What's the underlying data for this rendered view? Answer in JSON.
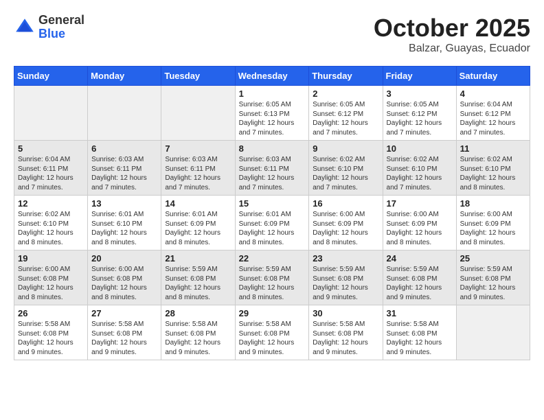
{
  "header": {
    "logo_general": "General",
    "logo_blue": "Blue",
    "month_title": "October 2025",
    "location": "Balzar, Guayas, Ecuador"
  },
  "days_of_week": [
    "Sunday",
    "Monday",
    "Tuesday",
    "Wednesday",
    "Thursday",
    "Friday",
    "Saturday"
  ],
  "weeks": [
    {
      "shaded": false,
      "days": [
        {
          "num": "",
          "info": ""
        },
        {
          "num": "",
          "info": ""
        },
        {
          "num": "",
          "info": ""
        },
        {
          "num": "1",
          "info": "Sunrise: 6:05 AM\nSunset: 6:13 PM\nDaylight: 12 hours\nand 7 minutes."
        },
        {
          "num": "2",
          "info": "Sunrise: 6:05 AM\nSunset: 6:12 PM\nDaylight: 12 hours\nand 7 minutes."
        },
        {
          "num": "3",
          "info": "Sunrise: 6:05 AM\nSunset: 6:12 PM\nDaylight: 12 hours\nand 7 minutes."
        },
        {
          "num": "4",
          "info": "Sunrise: 6:04 AM\nSunset: 6:12 PM\nDaylight: 12 hours\nand 7 minutes."
        }
      ]
    },
    {
      "shaded": true,
      "days": [
        {
          "num": "5",
          "info": "Sunrise: 6:04 AM\nSunset: 6:11 PM\nDaylight: 12 hours\nand 7 minutes."
        },
        {
          "num": "6",
          "info": "Sunrise: 6:03 AM\nSunset: 6:11 PM\nDaylight: 12 hours\nand 7 minutes."
        },
        {
          "num": "7",
          "info": "Sunrise: 6:03 AM\nSunset: 6:11 PM\nDaylight: 12 hours\nand 7 minutes."
        },
        {
          "num": "8",
          "info": "Sunrise: 6:03 AM\nSunset: 6:11 PM\nDaylight: 12 hours\nand 7 minutes."
        },
        {
          "num": "9",
          "info": "Sunrise: 6:02 AM\nSunset: 6:10 PM\nDaylight: 12 hours\nand 7 minutes."
        },
        {
          "num": "10",
          "info": "Sunrise: 6:02 AM\nSunset: 6:10 PM\nDaylight: 12 hours\nand 7 minutes."
        },
        {
          "num": "11",
          "info": "Sunrise: 6:02 AM\nSunset: 6:10 PM\nDaylight: 12 hours\nand 8 minutes."
        }
      ]
    },
    {
      "shaded": false,
      "days": [
        {
          "num": "12",
          "info": "Sunrise: 6:02 AM\nSunset: 6:10 PM\nDaylight: 12 hours\nand 8 minutes."
        },
        {
          "num": "13",
          "info": "Sunrise: 6:01 AM\nSunset: 6:10 PM\nDaylight: 12 hours\nand 8 minutes."
        },
        {
          "num": "14",
          "info": "Sunrise: 6:01 AM\nSunset: 6:09 PM\nDaylight: 12 hours\nand 8 minutes."
        },
        {
          "num": "15",
          "info": "Sunrise: 6:01 AM\nSunset: 6:09 PM\nDaylight: 12 hours\nand 8 minutes."
        },
        {
          "num": "16",
          "info": "Sunrise: 6:00 AM\nSunset: 6:09 PM\nDaylight: 12 hours\nand 8 minutes."
        },
        {
          "num": "17",
          "info": "Sunrise: 6:00 AM\nSunset: 6:09 PM\nDaylight: 12 hours\nand 8 minutes."
        },
        {
          "num": "18",
          "info": "Sunrise: 6:00 AM\nSunset: 6:09 PM\nDaylight: 12 hours\nand 8 minutes."
        }
      ]
    },
    {
      "shaded": true,
      "days": [
        {
          "num": "19",
          "info": "Sunrise: 6:00 AM\nSunset: 6:08 PM\nDaylight: 12 hours\nand 8 minutes."
        },
        {
          "num": "20",
          "info": "Sunrise: 6:00 AM\nSunset: 6:08 PM\nDaylight: 12 hours\nand 8 minutes."
        },
        {
          "num": "21",
          "info": "Sunrise: 5:59 AM\nSunset: 6:08 PM\nDaylight: 12 hours\nand 8 minutes."
        },
        {
          "num": "22",
          "info": "Sunrise: 5:59 AM\nSunset: 6:08 PM\nDaylight: 12 hours\nand 8 minutes."
        },
        {
          "num": "23",
          "info": "Sunrise: 5:59 AM\nSunset: 6:08 PM\nDaylight: 12 hours\nand 9 minutes."
        },
        {
          "num": "24",
          "info": "Sunrise: 5:59 AM\nSunset: 6:08 PM\nDaylight: 12 hours\nand 9 minutes."
        },
        {
          "num": "25",
          "info": "Sunrise: 5:59 AM\nSunset: 6:08 PM\nDaylight: 12 hours\nand 9 minutes."
        }
      ]
    },
    {
      "shaded": false,
      "days": [
        {
          "num": "26",
          "info": "Sunrise: 5:58 AM\nSunset: 6:08 PM\nDaylight: 12 hours\nand 9 minutes."
        },
        {
          "num": "27",
          "info": "Sunrise: 5:58 AM\nSunset: 6:08 PM\nDaylight: 12 hours\nand 9 minutes."
        },
        {
          "num": "28",
          "info": "Sunrise: 5:58 AM\nSunset: 6:08 PM\nDaylight: 12 hours\nand 9 minutes."
        },
        {
          "num": "29",
          "info": "Sunrise: 5:58 AM\nSunset: 6:08 PM\nDaylight: 12 hours\nand 9 minutes."
        },
        {
          "num": "30",
          "info": "Sunrise: 5:58 AM\nSunset: 6:08 PM\nDaylight: 12 hours\nand 9 minutes."
        },
        {
          "num": "31",
          "info": "Sunrise: 5:58 AM\nSunset: 6:08 PM\nDaylight: 12 hours\nand 9 minutes."
        },
        {
          "num": "",
          "info": ""
        }
      ]
    }
  ]
}
